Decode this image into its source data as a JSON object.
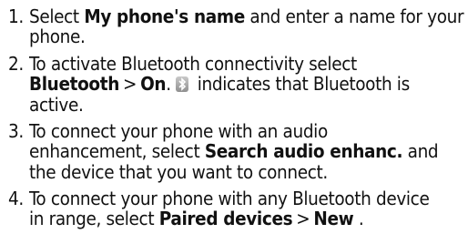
{
  "steps": [
    {
      "number": "1.",
      "line1_bold": "My phone's name",
      "line1_pre": "Select ",
      "line1_post": " and enter a name for your",
      "line2": "phone."
    },
    {
      "number": "2.",
      "line1": "To activate Bluetooth connectivity select",
      "line2_bold1": "Bluetooth",
      "line2_sep": ">",
      "line2_bold2": "On",
      "line2_post": " indicates that Bluetooth is",
      "line3": "active.",
      "icon": "bluetooth-status-icon"
    },
    {
      "number": "3.",
      "line1": "To connect your phone with an audio",
      "line2": "enhancement, select ",
      "line2_bold": "Search audio enhanc.",
      "line2_post": " and",
      "line3": "the device that you want to connect."
    },
    {
      "number": "4.",
      "line1": "To connect your phone with any Bluetooth device",
      "line2_pre": "in range, select ",
      "line2_bold1": "Paired devices",
      "line2_sep": ">",
      "line2_bold2": "New",
      "line2_post": " ."
    }
  ]
}
